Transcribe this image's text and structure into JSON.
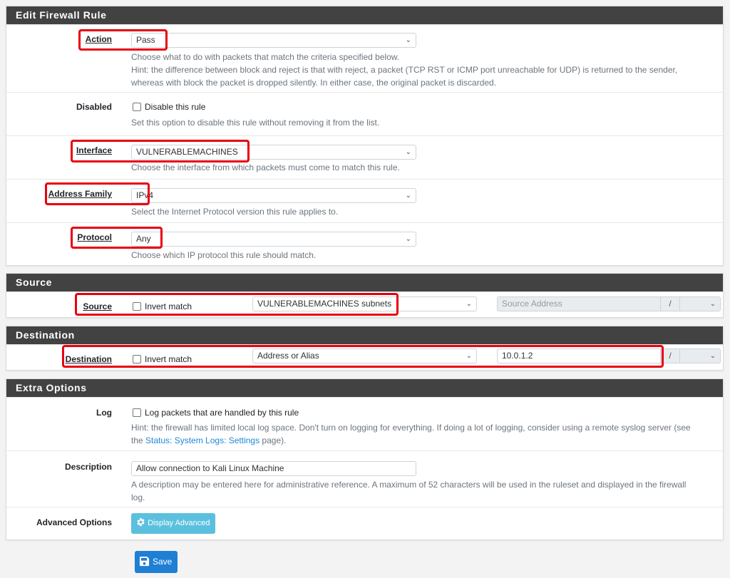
{
  "edit_rule": {
    "title": "Edit Firewall Rule",
    "action": {
      "label": "Action",
      "value": "Pass",
      "help_line1": "Choose what to do with packets that match the criteria specified below.",
      "help_line2": "Hint: the difference between block and reject is that with reject, a packet (TCP RST or ICMP port unreachable for UDP) is returned to the sender,",
      "help_line3": "whereas with block the packet is dropped silently. In either case, the original packet is discarded."
    },
    "disabled": {
      "label": "Disabled",
      "checkbox_label": "Disable this rule",
      "checked": false,
      "help": "Set this option to disable this rule without removing it from the list."
    },
    "interface": {
      "label": "Interface",
      "value": "VULNERABLEMACHINES",
      "help": "Choose the interface from which packets must come to match this rule."
    },
    "address_family": {
      "label": "Address Family",
      "value": "IPv4",
      "help": "Select the Internet Protocol version this rule applies to."
    },
    "protocol": {
      "label": "Protocol",
      "value": "Any",
      "help": "Choose which IP protocol this rule should match."
    }
  },
  "source": {
    "title": "Source",
    "label": "Source",
    "invert_label": "Invert match",
    "invert_checked": false,
    "type_value": "VULNERABLEMACHINES subnets",
    "address_placeholder": "Source Address",
    "slash": "/",
    "mask_value": ""
  },
  "destination": {
    "title": "Destination",
    "label": "Destination",
    "invert_label": "Invert match",
    "invert_checked": false,
    "type_value": "Address or Alias",
    "address_value": "10.0.1.2",
    "slash": "/",
    "mask_value": ""
  },
  "extra": {
    "title": "Extra Options",
    "log": {
      "label": "Log",
      "checkbox_label": "Log packets that are handled by this rule",
      "checked": false,
      "help_line1": "Hint: the firewall has limited local log space. Don't turn on logging for everything. If doing a lot of logging, consider using a remote syslog server (see",
      "help_pre": "the ",
      "help_link": "Status: System Logs: Settings",
      "help_post": " page)."
    },
    "description": {
      "label": "Description",
      "value": "Allow connection to Kali Linux Machine",
      "help_line1": "A description may be entered here for administrative reference. A maximum of 52 characters will be used in the ruleset and displayed in the firewall",
      "help_line2": "log."
    },
    "advanced": {
      "label": "Advanced Options",
      "button_label": "Display Advanced"
    }
  },
  "save_label": "Save",
  "colors": {
    "heading_bg": "#424242",
    "highlight": "#e8000f",
    "info_button": "#5bc0de",
    "primary_button": "#1e7fd4",
    "link": "#1e88d8"
  }
}
